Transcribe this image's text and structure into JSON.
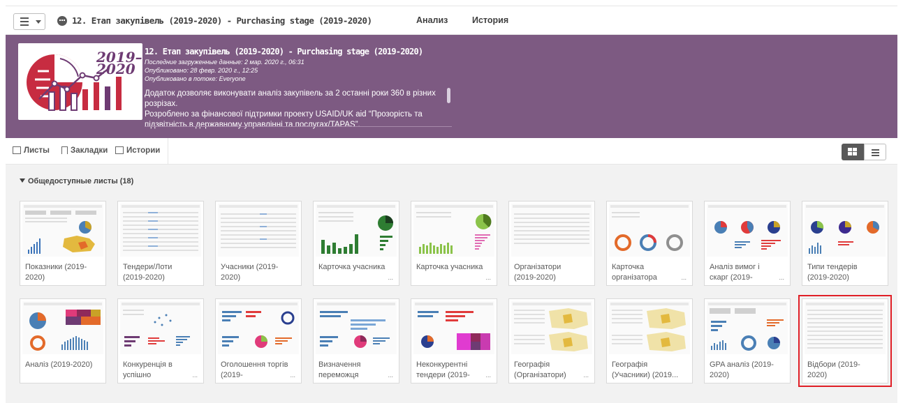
{
  "toolbar": {
    "app_title": "12. Етап закупівель (2019-2020) - Purchasing stage (2019-2020)",
    "tabs": [
      "Анализ",
      "История"
    ]
  },
  "header": {
    "title": "12. Етап закупівель (2019-2020) - Purchasing stage (2019-2020)",
    "last_loaded": "Последние загруженные данные: 2 мар. 2020 г., 06:31",
    "published": "Опубликовано: 28 февр. 2020 г., 12:25",
    "stream": "Опубликовано в потоке: Everyone",
    "description_line1": "Додаток дозволяє виконувати аналіз закупівель за 2 останні роки 360 в різних розрізах.",
    "description_line2": "Розроблено за фінансової підтримки проекту USAID/UK aid “Прозорість та підзвітність в державному управлінні та послугах/TAPAS”.",
    "logo_text_top": "2019–",
    "logo_text_bottom": "2020"
  },
  "tabs": {
    "sheets": "Листы",
    "bookmarks": "Закладки",
    "stories": "Истории"
  },
  "section": {
    "title": "Общедоступные листы (18)"
  },
  "cards_row1": [
    {
      "label": "Показники (2019-2020)",
      "ellipsis": ""
    },
    {
      "label": "Тендери/Лоти (2019-2020)",
      "ellipsis": ""
    },
    {
      "label": "Учасники (2019-2020)",
      "ellipsis": ""
    },
    {
      "label": "Карточка учасника",
      "ellipsis": "..."
    },
    {
      "label": "Карточка учасника",
      "ellipsis": "..."
    },
    {
      "label": "Організатори (2019-2020)",
      "ellipsis": ""
    },
    {
      "label": "Карточка організатора",
      "ellipsis": "..."
    },
    {
      "label": "Аналіз вимог і скарг (2019-",
      "ellipsis": "..."
    },
    {
      "label": "Типи тендерів (2019-2020)",
      "ellipsis": ""
    }
  ],
  "cards_row2": [
    {
      "label": "Аналіз (2019-2020)",
      "ellipsis": ""
    },
    {
      "label": "Конкуренція в успішно",
      "ellipsis": "..."
    },
    {
      "label": "Оголошення торгів (2019-",
      "ellipsis": "..."
    },
    {
      "label": "Визначення переможця",
      "ellipsis": "..."
    },
    {
      "label": "Неконкурентні тендери (2019-",
      "ellipsis": "..."
    },
    {
      "label": "Географія (Організатори)",
      "ellipsis": "..."
    },
    {
      "label": "Географія (Учасники) (2019...",
      "ellipsis": ""
    },
    {
      "label": "GPA аналіз (2019-2020)",
      "ellipsis": ""
    },
    {
      "label": "Відбори (2019-2020)",
      "ellipsis": ""
    }
  ],
  "colors": {
    "header_bg": "#7d5a82",
    "selection_outline": "#e01f26",
    "logo_red": "#c72c41",
    "logo_purple": "#6e3b73"
  }
}
